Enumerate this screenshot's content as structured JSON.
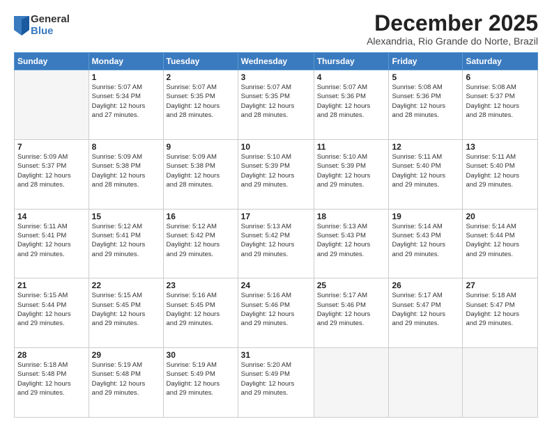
{
  "logo": {
    "general": "General",
    "blue": "Blue"
  },
  "title": "December 2025",
  "subtitle": "Alexandria, Rio Grande do Norte, Brazil",
  "days_of_week": [
    "Sunday",
    "Monday",
    "Tuesday",
    "Wednesday",
    "Thursday",
    "Friday",
    "Saturday"
  ],
  "weeks": [
    [
      {
        "day": "",
        "info": ""
      },
      {
        "day": "1",
        "info": "Sunrise: 5:07 AM\nSunset: 5:34 PM\nDaylight: 12 hours\nand 27 minutes."
      },
      {
        "day": "2",
        "info": "Sunrise: 5:07 AM\nSunset: 5:35 PM\nDaylight: 12 hours\nand 28 minutes."
      },
      {
        "day": "3",
        "info": "Sunrise: 5:07 AM\nSunset: 5:35 PM\nDaylight: 12 hours\nand 28 minutes."
      },
      {
        "day": "4",
        "info": "Sunrise: 5:07 AM\nSunset: 5:36 PM\nDaylight: 12 hours\nand 28 minutes."
      },
      {
        "day": "5",
        "info": "Sunrise: 5:08 AM\nSunset: 5:36 PM\nDaylight: 12 hours\nand 28 minutes."
      },
      {
        "day": "6",
        "info": "Sunrise: 5:08 AM\nSunset: 5:37 PM\nDaylight: 12 hours\nand 28 minutes."
      }
    ],
    [
      {
        "day": "7",
        "info": "Sunrise: 5:09 AM\nSunset: 5:37 PM\nDaylight: 12 hours\nand 28 minutes."
      },
      {
        "day": "8",
        "info": "Sunrise: 5:09 AM\nSunset: 5:38 PM\nDaylight: 12 hours\nand 28 minutes."
      },
      {
        "day": "9",
        "info": "Sunrise: 5:09 AM\nSunset: 5:38 PM\nDaylight: 12 hours\nand 28 minutes."
      },
      {
        "day": "10",
        "info": "Sunrise: 5:10 AM\nSunset: 5:39 PM\nDaylight: 12 hours\nand 29 minutes."
      },
      {
        "day": "11",
        "info": "Sunrise: 5:10 AM\nSunset: 5:39 PM\nDaylight: 12 hours\nand 29 minutes."
      },
      {
        "day": "12",
        "info": "Sunrise: 5:11 AM\nSunset: 5:40 PM\nDaylight: 12 hours\nand 29 minutes."
      },
      {
        "day": "13",
        "info": "Sunrise: 5:11 AM\nSunset: 5:40 PM\nDaylight: 12 hours\nand 29 minutes."
      }
    ],
    [
      {
        "day": "14",
        "info": "Sunrise: 5:11 AM\nSunset: 5:41 PM\nDaylight: 12 hours\nand 29 minutes."
      },
      {
        "day": "15",
        "info": "Sunrise: 5:12 AM\nSunset: 5:41 PM\nDaylight: 12 hours\nand 29 minutes."
      },
      {
        "day": "16",
        "info": "Sunrise: 5:12 AM\nSunset: 5:42 PM\nDaylight: 12 hours\nand 29 minutes."
      },
      {
        "day": "17",
        "info": "Sunrise: 5:13 AM\nSunset: 5:42 PM\nDaylight: 12 hours\nand 29 minutes."
      },
      {
        "day": "18",
        "info": "Sunrise: 5:13 AM\nSunset: 5:43 PM\nDaylight: 12 hours\nand 29 minutes."
      },
      {
        "day": "19",
        "info": "Sunrise: 5:14 AM\nSunset: 5:43 PM\nDaylight: 12 hours\nand 29 minutes."
      },
      {
        "day": "20",
        "info": "Sunrise: 5:14 AM\nSunset: 5:44 PM\nDaylight: 12 hours\nand 29 minutes."
      }
    ],
    [
      {
        "day": "21",
        "info": "Sunrise: 5:15 AM\nSunset: 5:44 PM\nDaylight: 12 hours\nand 29 minutes."
      },
      {
        "day": "22",
        "info": "Sunrise: 5:15 AM\nSunset: 5:45 PM\nDaylight: 12 hours\nand 29 minutes."
      },
      {
        "day": "23",
        "info": "Sunrise: 5:16 AM\nSunset: 5:45 PM\nDaylight: 12 hours\nand 29 minutes."
      },
      {
        "day": "24",
        "info": "Sunrise: 5:16 AM\nSunset: 5:46 PM\nDaylight: 12 hours\nand 29 minutes."
      },
      {
        "day": "25",
        "info": "Sunrise: 5:17 AM\nSunset: 5:46 PM\nDaylight: 12 hours\nand 29 minutes."
      },
      {
        "day": "26",
        "info": "Sunrise: 5:17 AM\nSunset: 5:47 PM\nDaylight: 12 hours\nand 29 minutes."
      },
      {
        "day": "27",
        "info": "Sunrise: 5:18 AM\nSunset: 5:47 PM\nDaylight: 12 hours\nand 29 minutes."
      }
    ],
    [
      {
        "day": "28",
        "info": "Sunrise: 5:18 AM\nSunset: 5:48 PM\nDaylight: 12 hours\nand 29 minutes."
      },
      {
        "day": "29",
        "info": "Sunrise: 5:19 AM\nSunset: 5:48 PM\nDaylight: 12 hours\nand 29 minutes."
      },
      {
        "day": "30",
        "info": "Sunrise: 5:19 AM\nSunset: 5:49 PM\nDaylight: 12 hours\nand 29 minutes."
      },
      {
        "day": "31",
        "info": "Sunrise: 5:20 AM\nSunset: 5:49 PM\nDaylight: 12 hours\nand 29 minutes."
      },
      {
        "day": "",
        "info": ""
      },
      {
        "day": "",
        "info": ""
      },
      {
        "day": "",
        "info": ""
      }
    ]
  ]
}
